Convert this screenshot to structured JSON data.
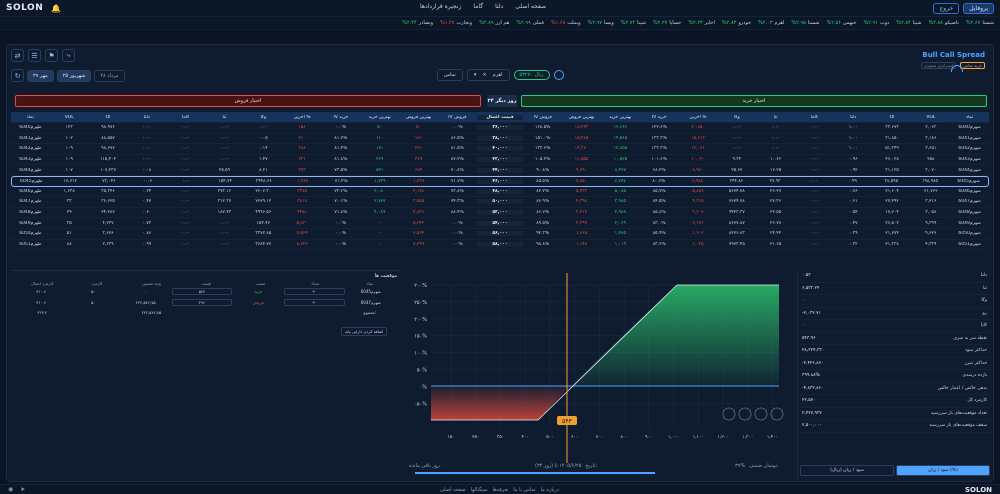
{
  "topbar": {
    "logo": "SOLON",
    "logo_sub": "...",
    "home": "صفحه اصلی",
    "delta": "دلتا",
    "gamma": "گاما",
    "contracts_chain": "زنجیره قراردادها",
    "user": "پروفایل",
    "logout": "خروج"
  },
  "ticker": [
    {
      "n": "شستا",
      "v": "۲.۶۷%",
      "c": "g"
    },
    {
      "n": "تاصیکو",
      "v": "۲.۸۸%",
      "c": "g"
    },
    {
      "n": "شپنا",
      "v": "۲.۸۴%",
      "c": "g"
    },
    {
      "n": "ذوب",
      "v": "۲.۹۱%",
      "c": "g"
    },
    {
      "n": "خبهمن",
      "v": "۲.۵۶%",
      "c": "g"
    },
    {
      "n": "شستا",
      "v": "۲.۹۵%",
      "c": "g"
    },
    {
      "n": "اهرم",
      "v": "۲.۰۳%",
      "c": "g"
    },
    {
      "n": "خودرو",
      "v": "۲.۸۳%",
      "c": "g"
    },
    {
      "n": "اخابر",
      "v": "۲.۲۳%",
      "c": "g"
    },
    {
      "n": "خساپا",
      "v": "۲.۲۷%",
      "c": "g"
    },
    {
      "n": "شپنا",
      "v": "۲.۷۲%",
      "c": "g"
    },
    {
      "n": "ویسا",
      "v": "۲.۹۷%",
      "c": "g"
    },
    {
      "n": "وبملت",
      "v": "۱.۶۸%",
      "c": "r"
    },
    {
      "n": "فملی",
      "v": "۲.۹۹%",
      "c": "g"
    },
    {
      "n": "هم ارز",
      "v": "۲.۸۹%",
      "c": "g"
    },
    {
      "n": "وتجارت",
      "v": "۱.۴۷%",
      "c": "r"
    },
    {
      "n": "وبصادر",
      "v": "۲.۴۴%",
      "c": "g"
    }
  ],
  "strategy": {
    "title": "Bull Call Spread",
    "tag1": "خرید تماس",
    "tag2": "استراتژی صعودی"
  },
  "dates": [
    {
      "label": "۲۸ مرداد",
      "active": false
    },
    {
      "label": "۲۵ شهریور",
      "active": true
    },
    {
      "label": "۲۹ مهر",
      "active": false
    }
  ],
  "filters": {
    "asset": "اهرم",
    "type": "تماس",
    "price": "۵۳۲۷۰ ریال"
  },
  "heads": {
    "call": "اختیار خرید",
    "put": "اختیار فروش",
    "days": "۳۴ روز دیگر"
  },
  "columns_call": [
    "نماد",
    "VOL",
    "OI",
    "دلتا",
    "گاما",
    "تتا",
    "وگا",
    "آخرین %",
    "IV خرید",
    "بهترین خرید",
    "بهترین فروش",
    "IV فروش"
  ],
  "mid_col": "قیمت اعمال",
  "columns_put": [
    "IV فروش",
    "بهترین فروش",
    "بهترین خرید",
    "IV خرید",
    "آخرین %",
    "وگا",
    "تتا",
    "گاما",
    "دلتا",
    "OI",
    "VOL",
    "نماد"
  ],
  "rows": [
    {
      "strike": "۳۶,۰۰۰",
      "cname": "ضهرم6040",
      "cvol": "۲,۰۶۳",
      "coi": "۳۳,۶۷۳",
      "cdelta": "۱.۰۰",
      "cgamma": "۰.۰۰",
      "ctheta": "۰.۰۰",
      "cvega": "۰.۰۰",
      "clast": "۲۰,۸۵۰",
      "civb": "۱۲۲.۶%",
      "cbb": "۱۶,۶۶۶",
      "cba": "۱۸,۲۳۳",
      "civa": "۱۶۸.۵%",
      "pivs": "۰.۰%",
      "pba": "۵۰",
      "pbb": "۵۰",
      "pivb": "۰.۰%",
      "plast": "۱۵۸",
      "pvega": "۰.۰۰",
      "ptheta": "۰.۰۰",
      "pgamma": "۰.۰۰",
      "pdelta": "۰.۰۰",
      "poi": "۹۸,۹۷۶",
      "pvol": "۱۲۳",
      "pname": "طهرم6040"
    },
    {
      "strike": "۳۸,۰۰۰",
      "cname": "ضهرم6041",
      "cvol": "۳,۱۸۶",
      "coi": "۳۱,۸۵۰",
      "cdelta": "۱.۰۰",
      "cgamma": "۰.۰۰",
      "ctheta": "۰.۰۰",
      "cvega": "۰.۰۰",
      "clast": "۱۵,۶۱۳",
      "civb": "۱۳۳.۳%",
      "cbb": "۱۴,۵۶۵",
      "cba": "۱۵,۴۸۵",
      "civa": "۱۵۱.۰%",
      "pivs": "۸۶.۵%",
      "pba": "۱۷۱",
      "pbb": "۱۱۰",
      "pivb": "۸۱.۷%",
      "plast": "۲۱۰",
      "pvega": "۰.۰۵",
      "ptheta": "۰.۰۰",
      "pgamma": "۰.۰۰",
      "pdelta": "۰.۰۰",
      "poi": "۸۸,۵۵۷",
      "pvol": "۱۰۲",
      "pname": "طهرم6041"
    },
    {
      "strike": "۴۰,۰۰۰",
      "cname": "ضهرم6042",
      "cvol": "۳,۶۵۱",
      "coi": "۵۱,۳۴۹",
      "cdelta": "۱.۰۰",
      "cgamma": "۰.۰۰",
      "ctheta": "۰.۰۰",
      "cvega": "۰.۰۰",
      "clast": "۱۲,۰۷۶",
      "civb": "۱۳۳.۳%",
      "cbb": "۱۲,۸۵۵",
      "cba": "۱۳,۳۷۰",
      "civa": "۱۳۳.۶%",
      "pivs": "۸۱.۵%",
      "pba": "۲۲۱",
      "pbb": "۱۷۱",
      "pivb": "۸۱.۴%",
      "plast": "۲۸۸",
      "pvega": "۰.۱۴",
      "ptheta": "۰.۰۰",
      "pgamma": "۰.۰۰",
      "pdelta": "۰.۰۰",
      "poi": "۹۸,۷۷۷",
      "pvol": "۱۰۹",
      "pname": "طهرم6042"
    },
    {
      "strike": "۴۲,۰۰۰",
      "cname": "ضهرم6043",
      "cvol": "۲۵۸",
      "coi": "۴۶,۰۲۸",
      "cdelta": "۰.۹۶",
      "cgamma": "۰.۰۰",
      "ctheta": "۱۰.۶۶",
      "cvega": "۹.۳۴",
      "clast": "۱۰,۰۲۰",
      "civb": "۱۰۱.۶%",
      "cbb": "۱۰,۵۲۵",
      "cba": "۱۱,۵۵۵",
      "civa": "۱۰۵.۲%",
      "pivs": "۸۷.۲%",
      "pba": "۳۸۹",
      "pbb": "۲۶۹",
      "pivb": "۸۱.۸%",
      "plast": "۲۳۱",
      "pvega": "۱.۴۷",
      "ptheta": "۰.۰۰",
      "pgamma": "۰.۰۰",
      "pdelta": "۰.۰۰",
      "poi": "۱۱۵,۴۰۲",
      "pvol": "۱۰۹",
      "pname": "طهرم6043"
    },
    {
      "strike": "۴۴,۰۰۰",
      "cname": "ضهرم6044",
      "cvol": "۳,۰۷۰",
      "coi": "۳۱,۱۲۵",
      "cdelta": "۰.۹۲",
      "cgamma": "۰.۰۰",
      "ctheta": "۱۶.۲۵",
      "cvega": "۲۵.۶۷",
      "clast": "۸,۹۷۰",
      "civb": "۶۸.۲%",
      "cbb": "۸,۴۷۷",
      "cba": "۹,۷۹۰",
      "civa": "۹۰.۸%",
      "pivs": "۷۰.۸%",
      "pba": "۶۷۴",
      "pbb": "۵۲۱",
      "pivb": "۷۳.۵%",
      "plast": "۳۷۳",
      "pvega": "۸.۲۱",
      "ptheta": "۲۵.۵۹",
      "pgamma": "۰.۰۰",
      "pdelta": "۰.۰۸",
      "poi": "۱۰۷,۲۳۷",
      "pvol": "۱۰۷",
      "pname": "طهرم6044"
    },
    {
      "strike": "۴۶,۰۰۰",
      "cname": "ضهرم6045",
      "cvol": "۱۹۸,۹۸۵",
      "coi": "۳۸,۵۹۵",
      "cdelta": "۰.۹۹",
      "cgamma": "۰.۰۰",
      "ctheta": "۲۷.۹۳",
      "cvega": "۳۴۴.۸۶",
      "clast": "۷,۹۸۸",
      "civb": "۸۰.۶%",
      "cbb": "۶,۷۷۷",
      "cba": "۷,۸۵۰",
      "civa": "۸۵.۵%",
      "pivs": "۷۱.۷%",
      "pba": "۱,۲۳۷",
      "pbb": "۱,۲۲۹",
      "pivb": "۷۱.۲%",
      "plast": "۱,۹۶۸",
      "pvega": "۳۴۴۸.۶۶",
      "ptheta": "۱۵۴.۷۴",
      "pgamma": "۰.۰۰",
      "pdelta": "۰.۰۷",
      "poi": "۷۳,۰۴۶",
      "pvol": "۱۷,۷۱۲",
      "pname": "طهرم6045",
      "hl": true
    },
    {
      "strike": "۴۸,۰۰۰",
      "cname": "ضهرم6046",
      "cvol": "۲۱,۷۶۲",
      "coi": "۲۱,۶۰۴",
      "cdelta": "۰.۷۶",
      "cgamma": "۰.۰۰",
      "ctheta": "۲۶.۲۷",
      "cvega": "۵۶۷۴.۷۸",
      "clast": "۵,۸۸۹",
      "civb": "۸۵.۷%",
      "cbb": "۵,۰۸۵",
      "cba": "۵,۴۳۳",
      "civa": "۸۲.۲%",
      "pivs": "۷۳.۸%",
      "pba": "۲,۱۴۸",
      "pbb": "۲,۰۸۰",
      "pivb": "۷۳.۶%",
      "plast": "۳۳۷۵",
      "pvega": "۲۶۰۶.۳۰",
      "ptheta": "۳۷۳.۱۶",
      "pgamma": "۰.۰۰",
      "pdelta": "۰.۲۴",
      "poi": "۳۵,۳۴۶",
      "pvol": "۱,۶۳۸",
      "pname": "طهرم6046"
    },
    {
      "strike": "۵۰,۰۰۰",
      "cname": "ضهرم6047",
      "cvol": "۳,۲۱۶",
      "coi": "۲۷,۴۹۲",
      "cdelta": "۰.۶۱",
      "cgamma": "۰.۰۰",
      "ctheta": "۲۷.۳۶",
      "cvega": "۷۶۷۴.۷۸",
      "clast": "۴,۳۱۵",
      "civb": "۸۴.۵%",
      "cbb": "۳,۹۸۵",
      "cba": "۴,۳۹۸",
      "civa": "۸۶.۹%",
      "pivs": "۷۴.۳%",
      "pba": "۳,۵۸۵",
      "pbb": "۲,۷۷۷",
      "pivb": "۷۰.۱%",
      "plast": "۳۸۱۸",
      "pvega": "۷۶۷۹.۱۲",
      "ptheta": "۳۱۲.۳۷",
      "pgamma": "۰.۰۰",
      "pdelta": "۰.۴۷",
      "poi": "۳۶,۶۲۵",
      "pvol": "۳۳",
      "pname": "طهرم6047"
    },
    {
      "strike": "۵۲,۰۰۰",
      "cname": "ضهرم6048",
      "cvol": "۳,۰۵۸",
      "coi": "۱۷,۷۰۴",
      "cdelta": "۰.۵۴",
      "cgamma": "۰.۰۰",
      "ctheta": "۲۲.۵۵",
      "cvega": "۹۴۴۳.۳۷",
      "clast": "۳,۳۰۷",
      "civb": "۸۵.۸%",
      "cbb": "۲,۹۸۸",
      "cba": "۳,۲۱۲",
      "civa": "۸۶.۷%",
      "pivs": "۸۸.۴%",
      "pba": "۴,۸۳۶",
      "pbb": "۴,۰۸۹",
      "pivb": "۷۱.۸%",
      "plast": "۴۴۵۱",
      "pvega": "۴۹۹۶.۵۶",
      "ptheta": "۱۸۷.۴۳",
      "pgamma": "۰.۰۰",
      "pdelta": "۰.۶۰",
      "poi": "۲۴,۲۸۲",
      "pvol": "۲۹",
      "pname": "طهرم6048"
    },
    {
      "strike": "۵۴,۰۰۰",
      "cname": "ضهرم6049",
      "cvol": "۹,۳۹۹",
      "coi": "۲۶,۵۰۲",
      "cdelta": "۰.۴۷",
      "cgamma": "۰.۰۰",
      "ctheta": "۲۶.۷۷",
      "cvega": "۸۶۷۷.۸۷",
      "clast": "۲,۱۷۶",
      "civb": "۸۳.۰%",
      "cbb": "۲,۰۶۹",
      "cba": "۲,۳۹۹",
      "civa": "۸۹.۵%",
      "pivs": "۰.۰%",
      "pba": "۵,۲۴۲",
      "pbb": "-",
      "pivb": "۰.۰%",
      "plast": "۵,۸۳۰",
      "pvega": "۱۵۴.۴۶",
      "ptheta": "۰.۰۰",
      "pgamma": "۰.۰۰",
      "pdelta": "۰.۷۳",
      "poi": "۴,۲۳۷",
      "pvol": "۳۵",
      "pname": "طهرم6049"
    },
    {
      "strike": "۵۶,۰۰۰",
      "cname": "ضهرم6050",
      "cvol": "۹,۶۲۶",
      "coi": "۲۱,۷۷۴",
      "cdelta": "۰.۳۹",
      "cgamma": "۰.۰۰",
      "ctheta": "۲۴.۴۴",
      "cvega": "۸۲۷۶.۸۳",
      "clast": "۱,۶۰۲",
      "civb": "۸۵.۹%",
      "cbb": "۱,۴۸۵",
      "cba": "۱,۶۶۵",
      "civa": "۹۲.۳%",
      "pivs": "۰.۰%",
      "pba": "۶,۵۶۴",
      "pbb": "-",
      "pivb": "۰.۰%",
      "plast": "۷,۵۶۴",
      "pvega": "۳۳۷۲.۸۵",
      "ptheta": "۰.۰۰",
      "pgamma": "۰.۰۰",
      "pdelta": "۰.۸۶",
      "poi": "۳,۶۷۶",
      "pvol": "۵۱",
      "pname": "طهرم6050"
    },
    {
      "strike": "۵۸,۰۰۰",
      "cname": "ضهرم6051",
      "cvol": "۴,۳۳۹",
      "coi": "۲۱,۳۳۸",
      "cdelta": "۰.۳۲",
      "cgamma": "۰.۰۰",
      "ctheta": "۲۱.۶۵",
      "cvega": "۷۹۷۳.۴۵",
      "clast": "۱,۰۲۵",
      "civb": "۸۳.۶%",
      "cbb": "۱,۰۱۹",
      "cba": "۱,۱۴۸",
      "civa": "۹۸.۸%",
      "pivs": "۰.۰%",
      "pba": "۷,۲۹۹",
      "pbb": "-",
      "pivb": "۰.۰%",
      "plast": "۸,۲۴۶",
      "pvega": "۳۶۸۴.۷۷",
      "ptheta": "۰.۰۰",
      "pgamma": "۰.۰۰",
      "pdelta": "۰.۹۹",
      "poi": "۲,۶۳۹",
      "pvol": "۸۸",
      "pname": "طهرم6051"
    }
  ],
  "positions": {
    "title": "موقعیت ها",
    "head": [
      "کارمزد اعمال",
      "کارمزد",
      "وجه تضمین",
      "قیمت",
      "سمت",
      "تعداد",
      "نماد"
    ],
    "rows": [
      {
        "fee_ex": "۳۱۰.۶",
        "fee": "۵۰",
        "margin": "۰",
        "price": "۵۴۴",
        "side": "خرید",
        "qty": "۳۰",
        "sym": "ضهرم6045"
      },
      {
        "fee_ex": "۳۱۰.۶",
        "fee": "۵۰",
        "margin": "۲۲۲,۵۴۶,۷۵",
        "price": "۴۹۶",
        "side": "فروش",
        "qty": "۳۰",
        "sym": "ضهرم6047"
      }
    ],
    "totals_label": "مجموع:",
    "totals_fee_ex": "۳۱۳.۲",
    "totals_margin": "۲۲۲,۵۴۶,۷۵",
    "add_btn": "اضافه کردن دارایی پایه"
  },
  "chart": {
    "y_ticks": [
      "۲۰۰%",
      "۲۵۰%",
      "۲۰۰%",
      "۱۵۰%",
      "۱۰۰%",
      "۵۰%",
      "۰%",
      "-۵۰%"
    ],
    "x_ticks": [
      "۱۵۰",
      "۲۵۰",
      "۳۵۰",
      "۴۰۰",
      "۵۰۰",
      "۶۰۰",
      "۷۰۰",
      "۸۰۰",
      "۹۰۰",
      "۱,۰۰۰",
      "۱,۱۰۰",
      "۱,۲۰۰",
      "۱,۳۰۰",
      "۱,۴۰۰"
    ],
    "marker": "۵۴۳",
    "foot_date_label": "تاریخ:",
    "foot_date": "(۳۴ روز) ۱۴۰۵/۶/۲۵ تا",
    "foot_days": "روز باقی مانده",
    "foot_days_val": "۰",
    "foot_ratio": "نوسان ضمنی:",
    "foot_ratio_val": "۳۹%"
  },
  "stats": [
    {
      "lbl": "دلتا",
      "val": "۰.۵۳"
    },
    {
      "lbl": "تتا",
      "val": "۶,۵۳۳.۲۴"
    },
    {
      "lbl": "وگا",
      "val": "۰"
    },
    {
      "lbl": "رو",
      "val": "-۲,۰۳۲.۷۱"
    },
    {
      "lbl": "کاپا",
      "val": "۰"
    },
    {
      "lbl": "نقطه سر به سری",
      "val": "۵۴۳.۹۶"
    },
    {
      "lbl": "حداکثر سود",
      "val": "۲۸,۳۲۴,۳۳۰"
    },
    {
      "lbl": "حداکثر ضرر",
      "val": "-۲,۴۲۶,۸۷۰"
    },
    {
      "lbl": "بازده درصدی",
      "val": "۳۹۹.۸۸%"
    },
    {
      "lbl": "بدهی خالص / اعتبار خالص",
      "val": "-۴,۸۳۲,۸۶۰"
    },
    {
      "lbl": "کارمزد کل",
      "val": "۲۲,۵۷۰"
    },
    {
      "lbl": "تعداد موقعیت‌های باز سررسید",
      "val": "۲,۴۲۷,۹۳۷"
    },
    {
      "lbl": "سقف موقعیت‌های باز سررسید",
      "val": "۲,۵۰۰,۰۰۰"
    }
  ],
  "stat_tabs": [
    "سود / زیان (ریال)",
    "سود / زیان (%)"
  ],
  "footer": {
    "links": [
      "صفحه اصلی",
      "سیگنالها",
      "تعرفه‌ها",
      "تماس با ما",
      "درباره ما"
    ],
    "logo": "SOLON"
  },
  "colors": {
    "accent": "#4fa3ff",
    "green": "#2ecc71",
    "red": "#e74c3c",
    "bg": "#0a1424"
  }
}
